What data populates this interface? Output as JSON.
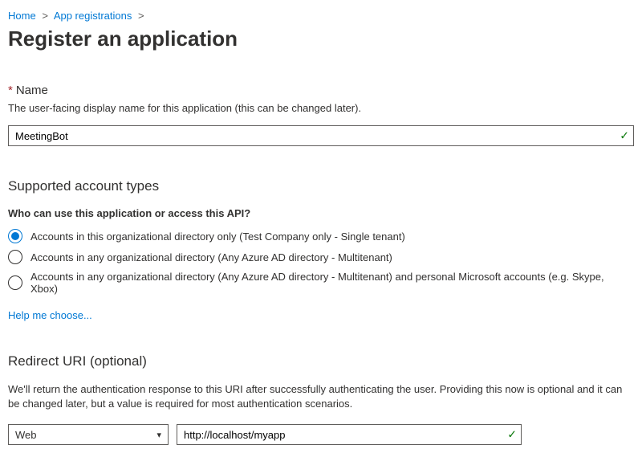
{
  "breadcrumb": {
    "home": "Home",
    "app_reg": "App registrations"
  },
  "page_title": "Register an application",
  "name_section": {
    "required_mark": "*",
    "label": "Name",
    "help": "The user-facing display name for this application (this can be changed later).",
    "value": "MeetingBot"
  },
  "account_types": {
    "title": "Supported account types",
    "subhead": "Who can use this application or access this API?",
    "options": [
      "Accounts in this organizational directory only (Test Company only - Single tenant)",
      "Accounts in any organizational directory (Any Azure AD directory - Multitenant)",
      "Accounts in any organizational directory (Any Azure AD directory - Multitenant) and personal Microsoft accounts (e.g. Skype, Xbox)"
    ],
    "selected_index": 0,
    "help_link": "Help me choose..."
  },
  "redirect": {
    "title": "Redirect URI (optional)",
    "desc": "We'll return the authentication response to this URI after successfully authenticating the user. Providing this now is optional and it can be changed later, but a value is required for most authentication scenarios.",
    "platform_value": "Web",
    "uri_value": "http://localhost/myapp"
  }
}
